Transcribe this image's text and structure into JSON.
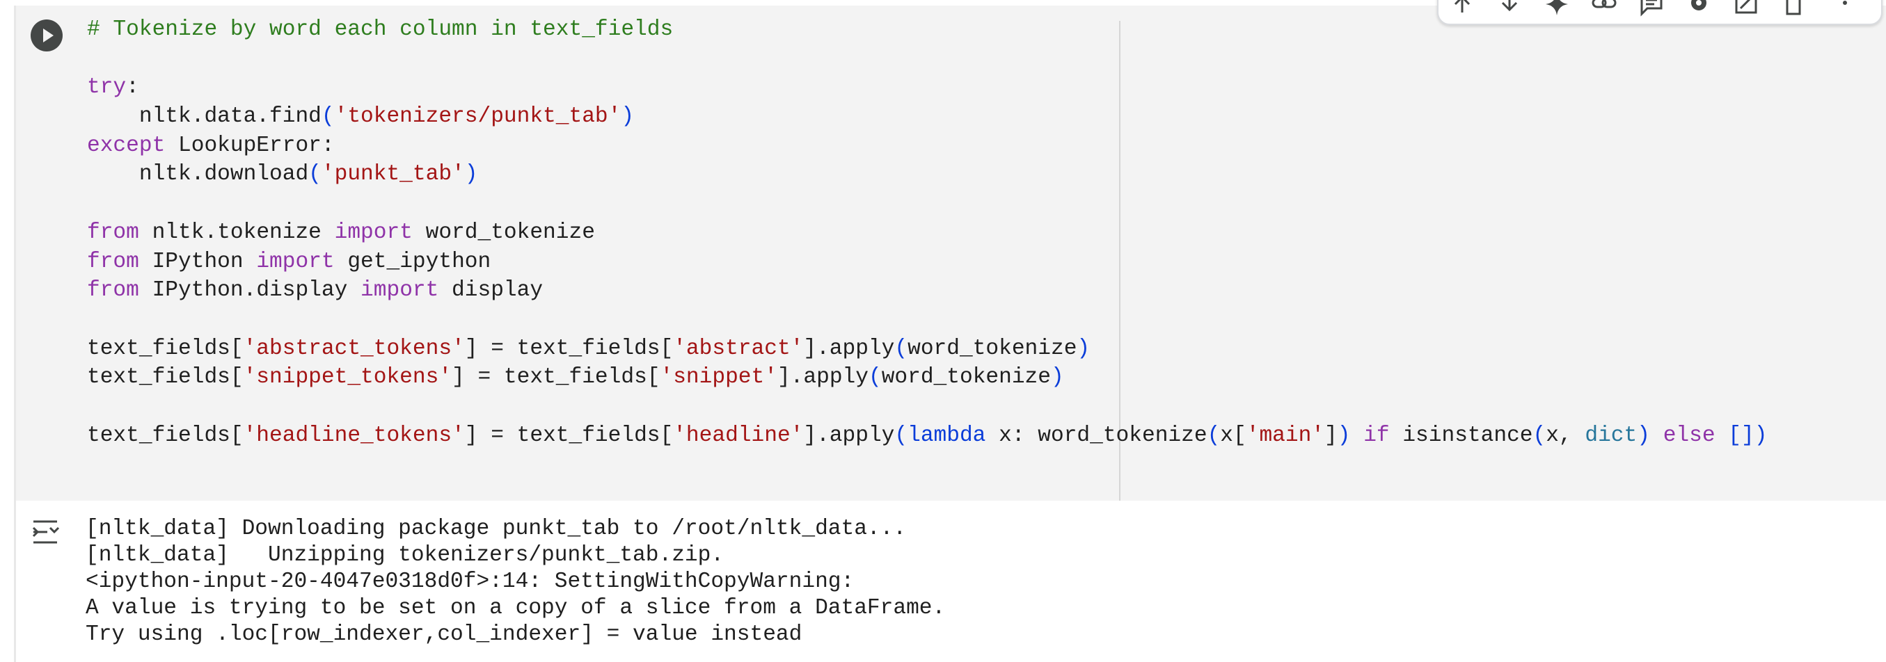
{
  "code_cell": {
    "lines": [
      [
        {
          "t": "# Tokenize by word each column in text_fields",
          "c": "comment"
        }
      ],
      [],
      [
        {
          "t": "try",
          "c": "kw"
        },
        {
          "t": ":",
          "c": ""
        }
      ],
      [
        {
          "t": "    nltk.data.find",
          "c": ""
        },
        {
          "t": "(",
          "c": "paren"
        },
        {
          "t": "'tokenizers/punkt_tab'",
          "c": "str"
        },
        {
          "t": ")",
          "c": "paren"
        }
      ],
      [
        {
          "t": "except",
          "c": "kw"
        },
        {
          "t": " LookupError:",
          "c": ""
        }
      ],
      [
        {
          "t": "    nltk.download",
          "c": ""
        },
        {
          "t": "(",
          "c": "paren"
        },
        {
          "t": "'punkt_tab'",
          "c": "str"
        },
        {
          "t": ")",
          "c": "paren"
        }
      ],
      [],
      [
        {
          "t": "from",
          "c": "kw"
        },
        {
          "t": " nltk.tokenize ",
          "c": ""
        },
        {
          "t": "import",
          "c": "kw"
        },
        {
          "t": " word_tokenize",
          "c": ""
        }
      ],
      [
        {
          "t": "from",
          "c": "kw"
        },
        {
          "t": " IPython ",
          "c": ""
        },
        {
          "t": "import",
          "c": "kw"
        },
        {
          "t": " get_ipython",
          "c": ""
        }
      ],
      [
        {
          "t": "from",
          "c": "kw"
        },
        {
          "t": " IPython.display ",
          "c": ""
        },
        {
          "t": "import",
          "c": "kw"
        },
        {
          "t": " display",
          "c": ""
        }
      ],
      [],
      [
        {
          "t": "text_fields[",
          "c": ""
        },
        {
          "t": "'abstract_tokens'",
          "c": "str"
        },
        {
          "t": "] = text_fields[",
          "c": ""
        },
        {
          "t": "'abstract'",
          "c": "str"
        },
        {
          "t": "].apply",
          "c": ""
        },
        {
          "t": "(",
          "c": "paren"
        },
        {
          "t": "word_tokenize",
          "c": ""
        },
        {
          "t": ")",
          "c": "paren"
        }
      ],
      [
        {
          "t": "text_fields[",
          "c": ""
        },
        {
          "t": "'snippet_tokens'",
          "c": "str"
        },
        {
          "t": "] = text_fields[",
          "c": ""
        },
        {
          "t": "'snippet'",
          "c": "str"
        },
        {
          "t": "].apply",
          "c": ""
        },
        {
          "t": "(",
          "c": "paren"
        },
        {
          "t": "word_tokenize",
          "c": ""
        },
        {
          "t": ")",
          "c": "paren"
        }
      ],
      [],
      [
        {
          "t": "text_fields[",
          "c": ""
        },
        {
          "t": "'headline_tokens'",
          "c": "str"
        },
        {
          "t": "] = text_fields[",
          "c": ""
        },
        {
          "t": "'headline'",
          "c": "str"
        },
        {
          "t": "].apply",
          "c": ""
        },
        {
          "t": "(",
          "c": "paren"
        },
        {
          "t": "lambda",
          "c": "bl"
        },
        {
          "t": " x: word_tokenize",
          "c": ""
        },
        {
          "t": "(",
          "c": "paren"
        },
        {
          "t": "x[",
          "c": ""
        },
        {
          "t": "'main'",
          "c": "str"
        },
        {
          "t": "]",
          "c": ""
        },
        {
          "t": ")",
          "c": "paren"
        },
        {
          "t": " ",
          "c": ""
        },
        {
          "t": "if",
          "c": "kw"
        },
        {
          "t": " ",
          "c": ""
        },
        {
          "t": "isinstance",
          "c": ""
        },
        {
          "t": "(",
          "c": "paren"
        },
        {
          "t": "x, ",
          "c": ""
        },
        {
          "t": "dict",
          "c": "builtin"
        },
        {
          "t": ")",
          "c": "paren"
        },
        {
          "t": " ",
          "c": ""
        },
        {
          "t": "else",
          "c": "kw"
        },
        {
          "t": " ",
          "c": ""
        },
        {
          "t": "[]",
          "c": "paren"
        },
        {
          "t": ")",
          "c": "paren"
        }
      ]
    ]
  },
  "output": {
    "lines": [
      "[nltk_data] Downloading package punkt_tab to /root/nltk_data...",
      "[nltk_data]   Unzipping tokenizers/punkt_tab.zip.",
      "<ipython-input-20-4047e0318d0f>:14: SettingWithCopyWarning:",
      "A value is trying to be set on a copy of a slice from a DataFrame.",
      "Try using .loc[row_indexer,col_indexer] = value instead"
    ]
  },
  "toolbar": {
    "icons": [
      "move-up-icon",
      "move-down-icon",
      "gemini-sparkle-icon",
      "link-icon",
      "comment-icon",
      "gear-icon",
      "mirror-cell-icon",
      "delete-icon",
      "more-vert-icon"
    ]
  },
  "colors": {
    "comment": "#2e7d1e",
    "keyword": "#8f33a8",
    "string": "#a31515",
    "paren": "#0b3dd9",
    "builtin": "#26769b",
    "cell_bg": "#f3f3f3"
  }
}
